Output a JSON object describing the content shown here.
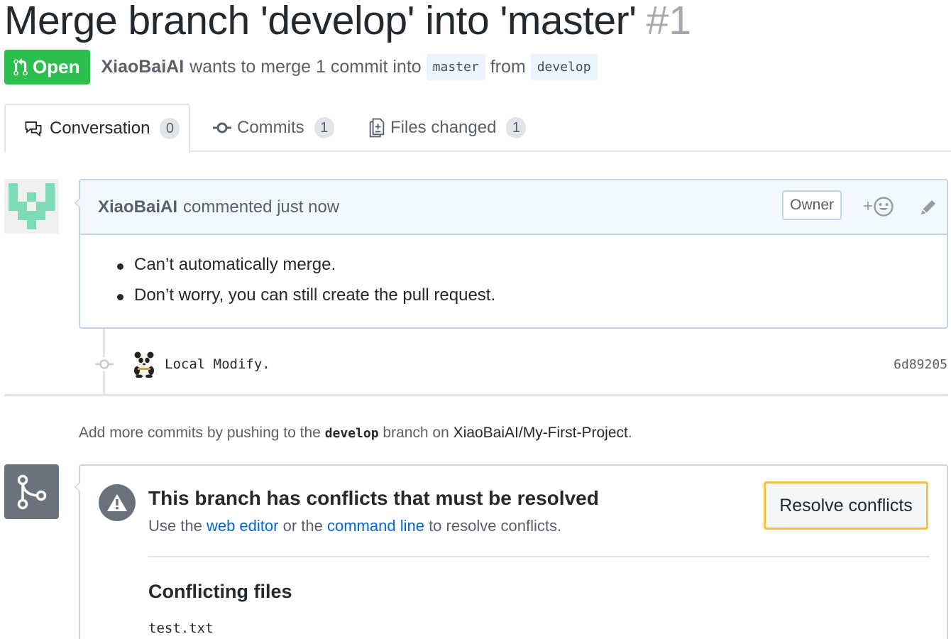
{
  "pr": {
    "title": "Merge branch 'develop' into 'master'",
    "number": "#1",
    "state": "Open",
    "author": "XiaoBaiAI",
    "summary": "wants to merge 1 commit into",
    "base_branch": "master",
    "from_text": "from",
    "head_branch": "develop"
  },
  "tabs": [
    {
      "label": "Conversation",
      "count": "0",
      "icon": "comment-discussion-icon"
    },
    {
      "label": "Commits",
      "count": "1",
      "icon": "git-commit-icon"
    },
    {
      "label": "Files changed",
      "count": "1",
      "icon": "file-diff-icon"
    }
  ],
  "comment": {
    "author": "XiaoBaiAI",
    "action": "commented just now",
    "role_label": "Owner",
    "react_plus": "+",
    "body": [
      "Can’t automatically merge.",
      "Don’t worry, you can still create the pull request."
    ]
  },
  "commit": {
    "message": "Local Modify.",
    "sha": "6d89205"
  },
  "hint": {
    "prefix": "Add more commits by pushing to the",
    "branch": "develop",
    "middle": "branch on",
    "repo": "XiaoBaiAI/My-First-Project",
    "suffix": "."
  },
  "merge": {
    "title": "This branch has conflicts that must be resolved",
    "desc_prefix": "Use the",
    "web_editor": "web editor",
    "desc_middle": "or the",
    "command_line": "command line",
    "desc_suffix": "to resolve conflicts.",
    "button": "Resolve conflicts",
    "files_heading": "Conflicting files",
    "files": [
      "test.txt"
    ]
  },
  "colors": {
    "open_green": "#2cbe4e",
    "link_blue": "#0366d6",
    "highlight_yellow": "#f6c343",
    "header_blue": "#f1f8ff",
    "identicon": "#7ddbb5"
  }
}
